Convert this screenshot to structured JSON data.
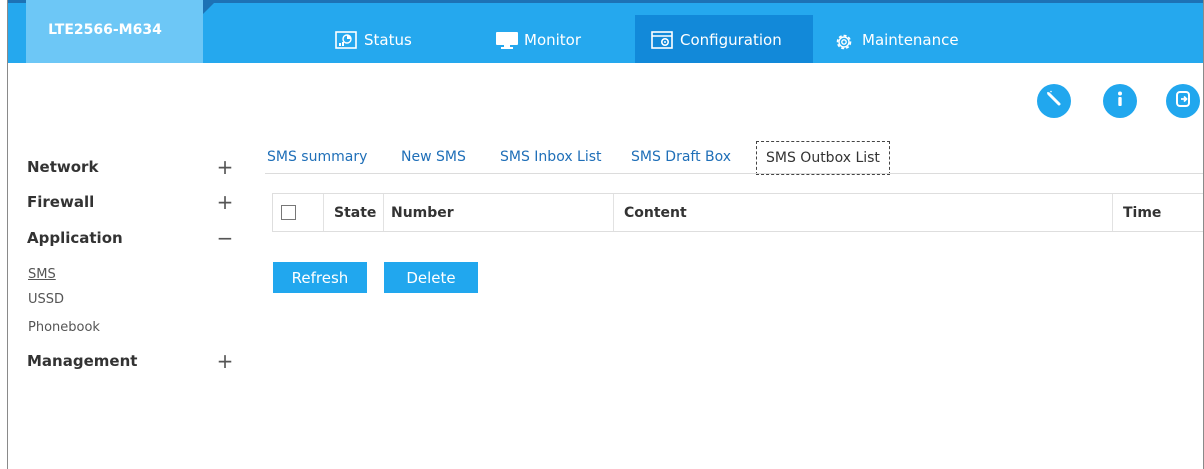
{
  "header": {
    "model": "LTE2566-M634",
    "nav": [
      {
        "label": "Status",
        "icon": "status-icon"
      },
      {
        "label": "Monitor",
        "icon": "monitor-icon"
      },
      {
        "label": "Configuration",
        "icon": "configuration-icon"
      },
      {
        "label": "Maintenance",
        "icon": "maintenance-gear-icon"
      }
    ],
    "active_nav": "Configuration",
    "actions": [
      "wizard-icon",
      "info-icon",
      "logout-icon"
    ]
  },
  "sidebar": {
    "items": [
      {
        "label": "Network",
        "sign": "+"
      },
      {
        "label": "Firewall",
        "sign": "+"
      },
      {
        "label": "Application",
        "sign": "−"
      },
      {
        "label": "Management",
        "sign": "+"
      }
    ],
    "subitems": [
      {
        "label": "SMS",
        "active": true
      },
      {
        "label": "USSD"
      },
      {
        "label": "Phonebook"
      }
    ]
  },
  "tabs": [
    {
      "label": "SMS summary"
    },
    {
      "label": "New SMS"
    },
    {
      "label": "SMS Inbox List"
    },
    {
      "label": "SMS Draft Box"
    },
    {
      "label": "SMS Outbox List",
      "active": true
    }
  ],
  "table": {
    "columns": [
      "State",
      "Number",
      "Content",
      "Time"
    ],
    "rows": []
  },
  "buttons": {
    "refresh": "Refresh",
    "delete": "Delete"
  },
  "colors": {
    "nav_bg": "#25a8ee",
    "nav_active": "#1289d9",
    "model_box": "#6dc7f6",
    "link": "#1f6fb8",
    "button": "#21a7ee"
  }
}
